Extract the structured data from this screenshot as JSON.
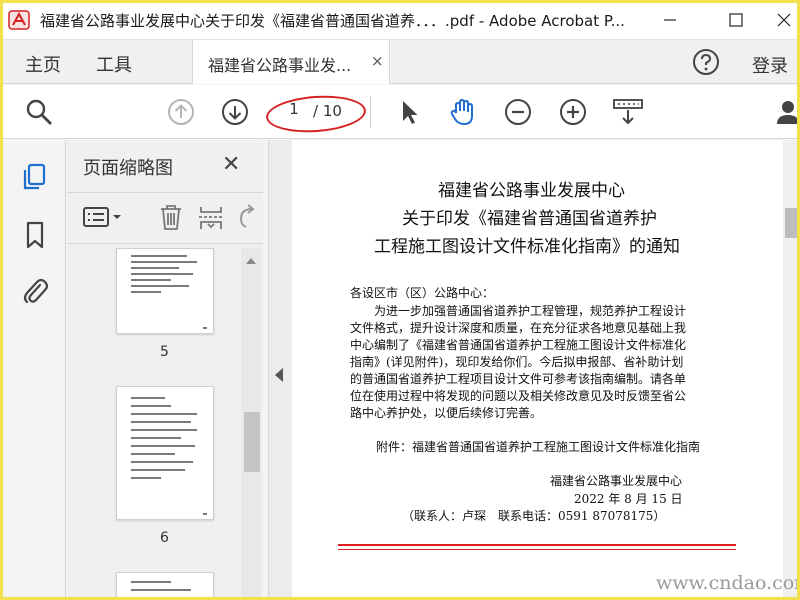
{
  "window": {
    "title": "福建省公路事业发展中心关于印发《福建省普通国省道养．．．.pdf - Adobe Acrobat P..."
  },
  "menu": {
    "home": "主页",
    "tools": "工具",
    "document_tab": "福建省公路事业发...",
    "tab_close": "×",
    "login": "登录"
  },
  "toolbar": {
    "current_page": "1",
    "total_pages": "/ 10"
  },
  "panel": {
    "title": "页面缩略图",
    "close": "✕",
    "thumbnails": [
      {
        "page": "5"
      },
      {
        "page": "6"
      }
    ]
  },
  "document": {
    "title_lines": [
      "福建省公路事业发展中心",
      "关于印发《福建省普通国省道养护",
      "工程施工图设计文件标准化指南》的通知"
    ],
    "body_lines": [
      "各设区市（区）公路中心：",
      "为进一步加强普通国省道养护工程管理，规范养护工程设计",
      "文件格式，提升设计深度和质量，在充分征求各地意见基础上我",
      "中心编制了《福建省普通国省道养护工程施工图设计文件标准化",
      "指南》(详见附件)，现印发给你们。今后拟申报部、省补助计划",
      "的普通国省道养护工程项目设计文件可参考该指南编制。请各单",
      "位在使用过程中将发现的问题以及相关修改意见及时反馈至省公",
      "路中心养护处，以便后续修订完善。"
    ],
    "attachment": "附件：福建省普通国省道养护工程施工图设计文件标准化指南",
    "signature": {
      "org": "福建省公路事业发展中心",
      "date": "2022 年 8 月 15 日",
      "contact": "（联系人：卢琛　联系电话：0591 87078175）"
    }
  },
  "watermark": "www.cndao.com",
  "colors": {
    "accent_blue": "#1f6fd1",
    "annotation_red": "#d42020",
    "frame_yellow": "#f2e14a"
  }
}
